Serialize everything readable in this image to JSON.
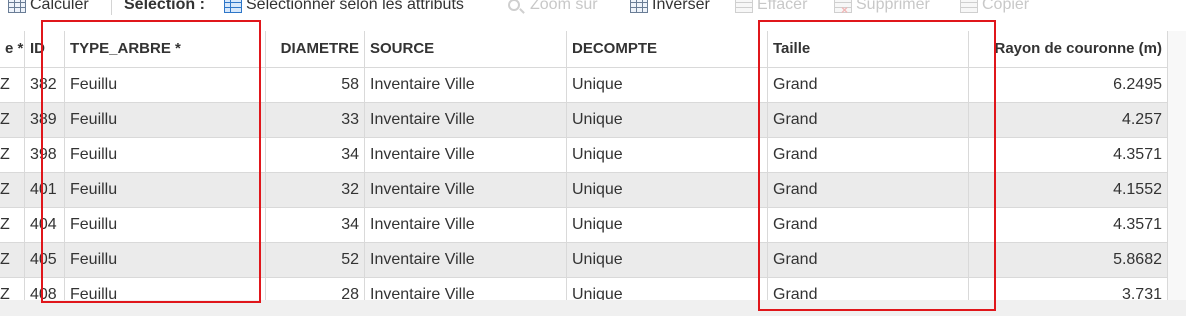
{
  "toolbar": {
    "calculer": "Calculer",
    "selection_label": "Sélection :",
    "select_by_attributes": "Sélectionner selon les attributs",
    "zoom_sur": "Zoom sur",
    "inverser": "Inverser",
    "effacer": "Effacer",
    "supprimer": "Supprimer",
    "copier": "Copier"
  },
  "table": {
    "headers": {
      "clipped": "e *",
      "id": "ID",
      "type_arbre": "TYPE_ARBRE *",
      "diametre": "DIAMETRE",
      "source": "SOURCE",
      "decompte": "DECOMPTE",
      "taille": "Taille",
      "rayon": "Rayon de couronne (m)"
    },
    "rows": [
      {
        "clipped": "Z",
        "id": "382",
        "type_arbre": "Feuillu",
        "diametre": "58",
        "source": "Inventaire Ville",
        "decompte": "Unique",
        "taille": "Grand",
        "rayon": "6.2495"
      },
      {
        "clipped": "Z",
        "id": "389",
        "type_arbre": "Feuillu",
        "diametre": "33",
        "source": "Inventaire Ville",
        "decompte": "Unique",
        "taille": "Grand",
        "rayon": "4.257"
      },
      {
        "clipped": "Z",
        "id": "398",
        "type_arbre": "Feuillu",
        "diametre": "34",
        "source": "Inventaire Ville",
        "decompte": "Unique",
        "taille": "Grand",
        "rayon": "4.3571"
      },
      {
        "clipped": "Z",
        "id": "401",
        "type_arbre": "Feuillu",
        "diametre": "32",
        "source": "Inventaire Ville",
        "decompte": "Unique",
        "taille": "Grand",
        "rayon": "4.1552"
      },
      {
        "clipped": "Z",
        "id": "404",
        "type_arbre": "Feuillu",
        "diametre": "34",
        "source": "Inventaire Ville",
        "decompte": "Unique",
        "taille": "Grand",
        "rayon": "4.3571"
      },
      {
        "clipped": "Z",
        "id": "405",
        "type_arbre": "Feuillu",
        "diametre": "52",
        "source": "Inventaire Ville",
        "decompte": "Unique",
        "taille": "Grand",
        "rayon": "5.8682"
      },
      {
        "clipped": "Z",
        "id": "408",
        "type_arbre": "Feuillu",
        "diametre": "28",
        "source": "Inventaire Ville",
        "decompte": "Unique",
        "taille": "Grand",
        "rayon": "3.731"
      }
    ]
  },
  "colors": {
    "row_odd": "#ffffff",
    "row_even": "#ebebeb",
    "annotation": "#e0161b",
    "disabled_text": "#c8c8c8"
  },
  "icons": [
    "calculate-table-icon",
    "select-by-attributes-icon",
    "zoom-to-icon",
    "invert-selection-icon",
    "clear-selection-icon",
    "delete-icon",
    "copy-icon"
  ]
}
